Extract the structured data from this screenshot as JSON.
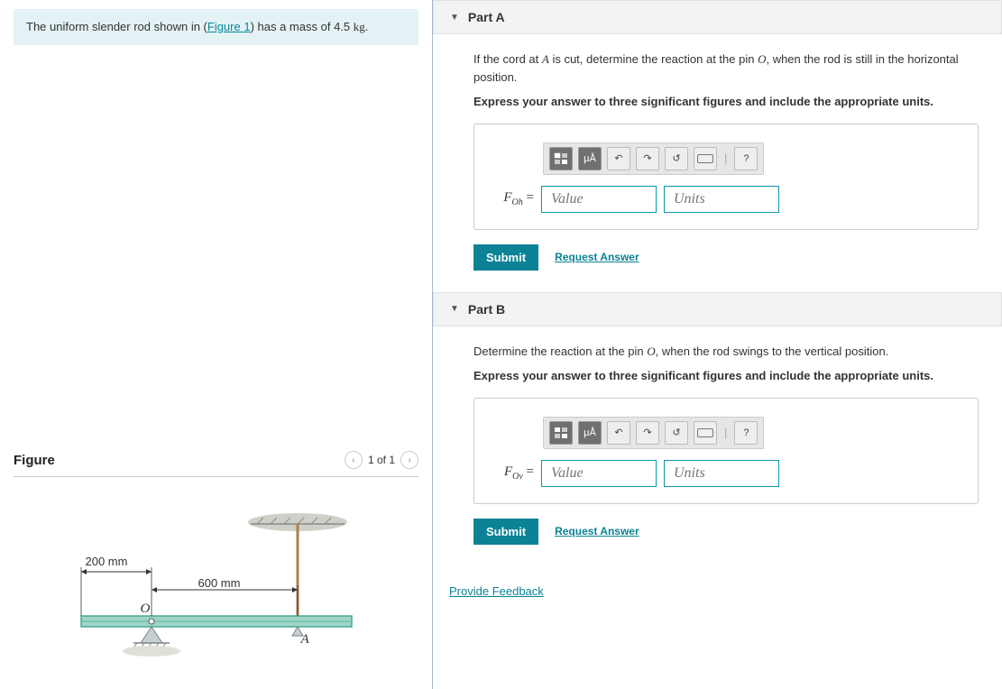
{
  "problem": {
    "prefix": "The uniform slender rod shown in (",
    "figure_link": "Figure 1",
    "suffix_before_mass": ") has a mass of ",
    "mass": "4.5",
    "mass_unit": "kg",
    "suffix": "."
  },
  "figure": {
    "title": "Figure",
    "page_indicator": "1 of 1",
    "dim1": "200 mm",
    "dim2": "600 mm",
    "pin_label": "O",
    "cord_label": "A"
  },
  "partA": {
    "header": "Part A",
    "prompt_pre": "If the cord at ",
    "prompt_varA": "A",
    "prompt_mid": " is cut, determine the reaction at the pin ",
    "prompt_varO": "O",
    "prompt_post": ", when the rod is still in the horizontal position.",
    "express": "Express your answer to three significant figures and include the appropriate units.",
    "var_letter": "F",
    "var_sub": "Oh",
    "eq": "=",
    "value_placeholder": "Value",
    "units_placeholder": "Units",
    "submit": "Submit",
    "request": "Request Answer"
  },
  "partB": {
    "header": "Part B",
    "prompt_pre": "Determine the reaction at the pin ",
    "prompt_varO": "O",
    "prompt_post": ", when the rod swings to the vertical position.",
    "express": "Express your answer to three significant figures and include the appropriate units.",
    "var_letter": "F",
    "var_sub": "Ov",
    "eq": "=",
    "value_placeholder": "Value",
    "units_placeholder": "Units",
    "submit": "Submit",
    "request": "Request Answer"
  },
  "toolbar": {
    "template": "template",
    "special": "μÅ",
    "undo": "undo",
    "redo": "redo",
    "reset": "reset",
    "keyboard": "keyboard",
    "help": "?"
  },
  "feedback_link": "Provide Feedback"
}
